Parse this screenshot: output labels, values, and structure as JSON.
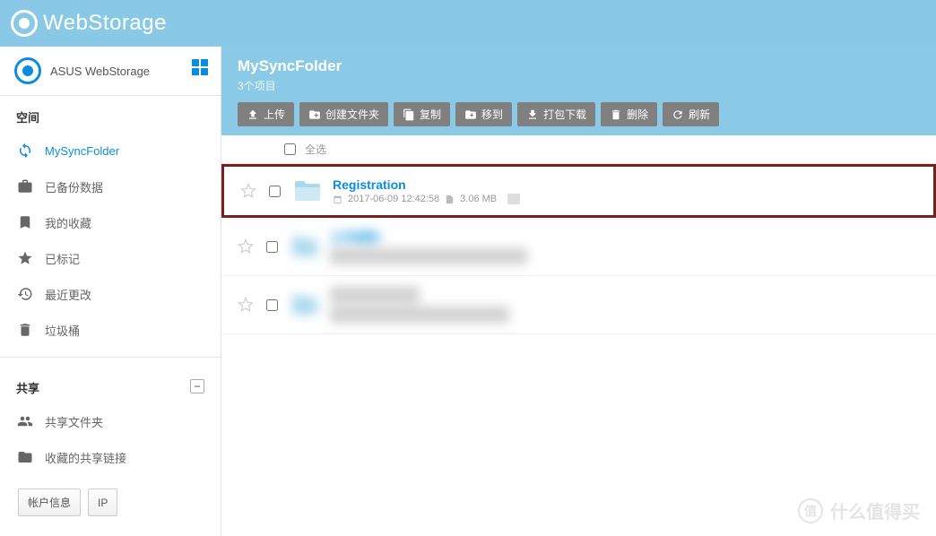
{
  "header": {
    "brand": "WebStorage"
  },
  "account": {
    "name": "ASUS WebStorage"
  },
  "sidebar": {
    "section_space": "空间",
    "section_share": "共享",
    "items": [
      {
        "label": "MySyncFolder"
      },
      {
        "label": "已备份数据"
      },
      {
        "label": "我的收藏"
      },
      {
        "label": "已标记"
      },
      {
        "label": "最近更改"
      },
      {
        "label": "垃圾桶"
      }
    ],
    "share_items": [
      {
        "label": "共享文件夹"
      },
      {
        "label": "收藏的共享链接"
      }
    ],
    "footer": {
      "account_info": "帐户信息",
      "ip": "IP"
    }
  },
  "main": {
    "title": "MySyncFolder",
    "subtitle": "3个项目",
    "toolbar": {
      "upload": "上传",
      "new_folder": "创建文件夹",
      "copy": "复制",
      "move": "移到",
      "download": "打包下载",
      "delete": "删除",
      "refresh": "刷新"
    },
    "select_all": "全选",
    "files": [
      {
        "name": "Registration",
        "date": "2017-06-09 12:42:58",
        "size": "3.06 MB"
      },
      {
        "name": "工作资料"
      },
      {
        "name": ""
      }
    ]
  },
  "watermark": {
    "text": "什么值得买",
    "symbol": "值"
  }
}
